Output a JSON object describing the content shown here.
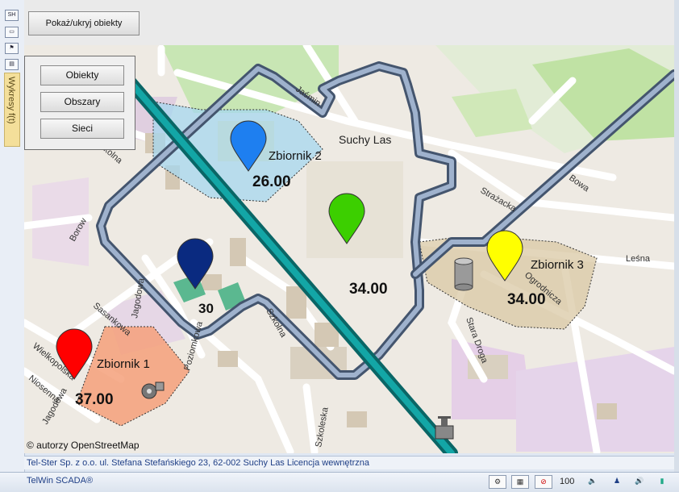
{
  "toolbar": {
    "toggle_label": "Pokaż/ukryj obiekty"
  },
  "left_strip": {
    "buttons": [
      "SH",
      "",
      "",
      ""
    ],
    "tab_label": "Wykresy f(t)"
  },
  "panel": {
    "buttons": [
      "Obiekty",
      "Obszary",
      "Sieci"
    ]
  },
  "map": {
    "streets": [
      "Jaśmin",
      "Suchy Las",
      "Szkolna",
      "Borow",
      "Jagodowa",
      "Sasankowa",
      "Wielkopolska",
      "Niosenna",
      "Jagodowa",
      "Poziomkowa",
      "Szkolna",
      "Strażacka",
      "Bowa",
      "Leśna",
      "Ogrodnicza",
      "Stara Droga",
      "Szkoleska"
    ],
    "tanks": [
      {
        "name": "Zbiornik 1",
        "value": "37.00",
        "color": "#ff0000"
      },
      {
        "name": "Zbiornik 2",
        "value": "26.00",
        "color": "#1e7ff0"
      },
      {
        "name": "Zbiornik 3",
        "value": "34.00",
        "color": "#ffff00"
      },
      {
        "name": "",
        "value": "34.00",
        "color": "#3ccf00"
      },
      {
        "name": "",
        "value": "30",
        "color": "#0a2a80"
      }
    ],
    "attribution": "© autorzy OpenStreetMap"
  },
  "status": {
    "info_line": "Tel-Ster Sp. z o.o. ul. Stefana Stefańskiego 23, 62-002 Suchy Las Licencja wewnętrzna",
    "app_name": "TelWin SCADA®",
    "zoom": "100"
  }
}
